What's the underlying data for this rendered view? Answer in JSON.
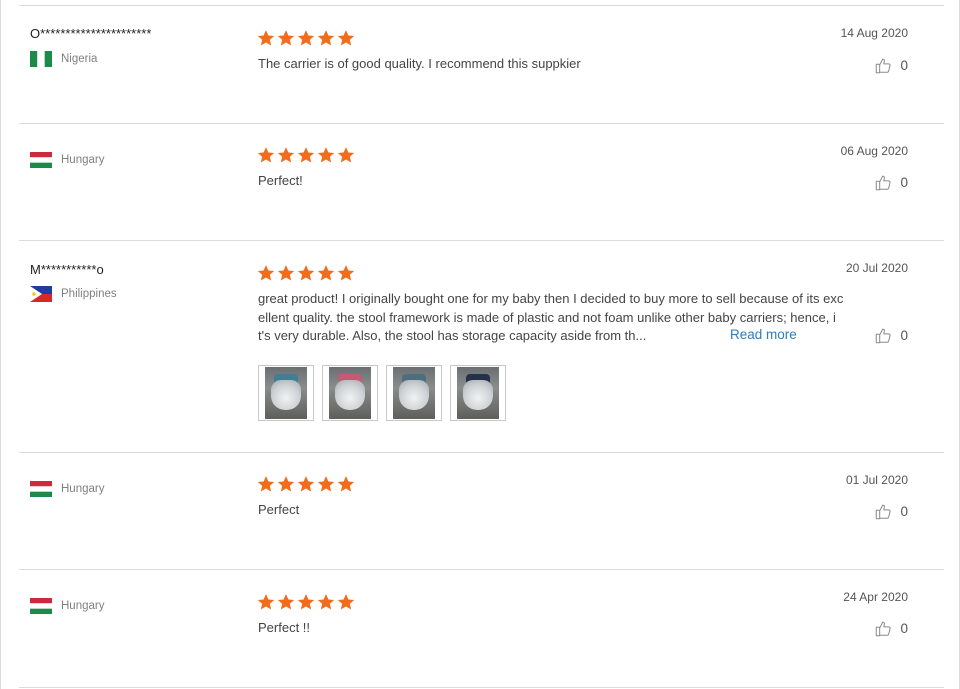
{
  "reviews": [
    {
      "user": "O**********************",
      "country": "Nigeria",
      "flag": "nigeria",
      "rating": 5,
      "text": "The carrier is of good quality. I recommend this suppkier",
      "date": "14 Aug 2020",
      "helpful": "0"
    },
    {
      "user": "",
      "country": "Hungary",
      "flag": "hungary",
      "rating": 5,
      "text": "Perfect!",
      "date": "06 Aug 2020",
      "helpful": "0"
    },
    {
      "user": "M***********o",
      "country": "Philippines",
      "flag": "philippines",
      "rating": 5,
      "text_lines": [
        "great product! I originally bought one for my baby then I decided to buy more to sell because of its exc",
        "ellent quality. the stool framework is made of plastic and not foam unlike other baby carriers; hence, i",
        "t's very durable. Also, the stool has storage capacity aside from th..."
      ],
      "read_more": "Read more",
      "date": "20 Jul 2020",
      "helpful": "0",
      "images": [
        {
          "strap_color": "#3f7f96"
        },
        {
          "strap_color": "#c45a74"
        },
        {
          "strap_color": "#4d6f7d"
        },
        {
          "strap_color": "#253049"
        }
      ]
    },
    {
      "user": "",
      "country": "Hungary",
      "flag": "hungary",
      "rating": 5,
      "text": "Perfect",
      "date": "01 Jul 2020",
      "helpful": "0"
    },
    {
      "user": "",
      "country": "Hungary",
      "flag": "hungary",
      "rating": 5,
      "text": "Perfect !!",
      "date": "24 Apr 2020",
      "helpful": "0"
    }
  ],
  "icons": {
    "star": "star-icon",
    "thumb": "thumbs-up-icon"
  },
  "colors": {
    "star": "#f26c1c",
    "link": "#2a7fc1",
    "flag_green": "#1c8a4a",
    "flag_red": "#cd2a3e",
    "ph_blue": "#1f3d9c",
    "ph_red": "#d12a2a",
    "ph_sun": "#f3c921"
  }
}
